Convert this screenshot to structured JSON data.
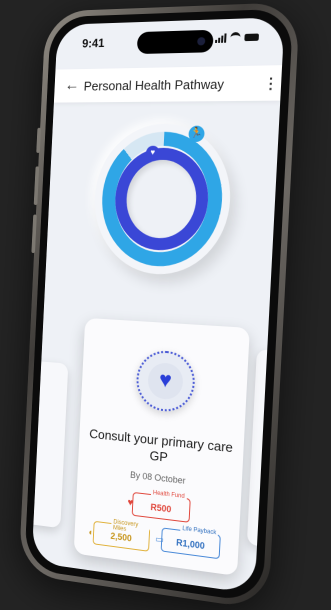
{
  "status": {
    "time": "9:41"
  },
  "appbar": {
    "title": "Personal Health Pathway"
  },
  "card": {
    "title": "Consult your primary care GP",
    "due": "By 08 October",
    "rewards": [
      {
        "label": "Health Fund",
        "value": "R500",
        "color": "#e0473c"
      },
      {
        "label": "Discovery Miles",
        "value": "2,500",
        "color": "#e0b13a"
      },
      {
        "label": "Life Payback",
        "value": "R1,000",
        "color": "#4a8ad8"
      }
    ]
  },
  "colors": {
    "ring_outer": "#2fa6e6",
    "ring_inner": "#3a47d6",
    "background": "#232323"
  }
}
